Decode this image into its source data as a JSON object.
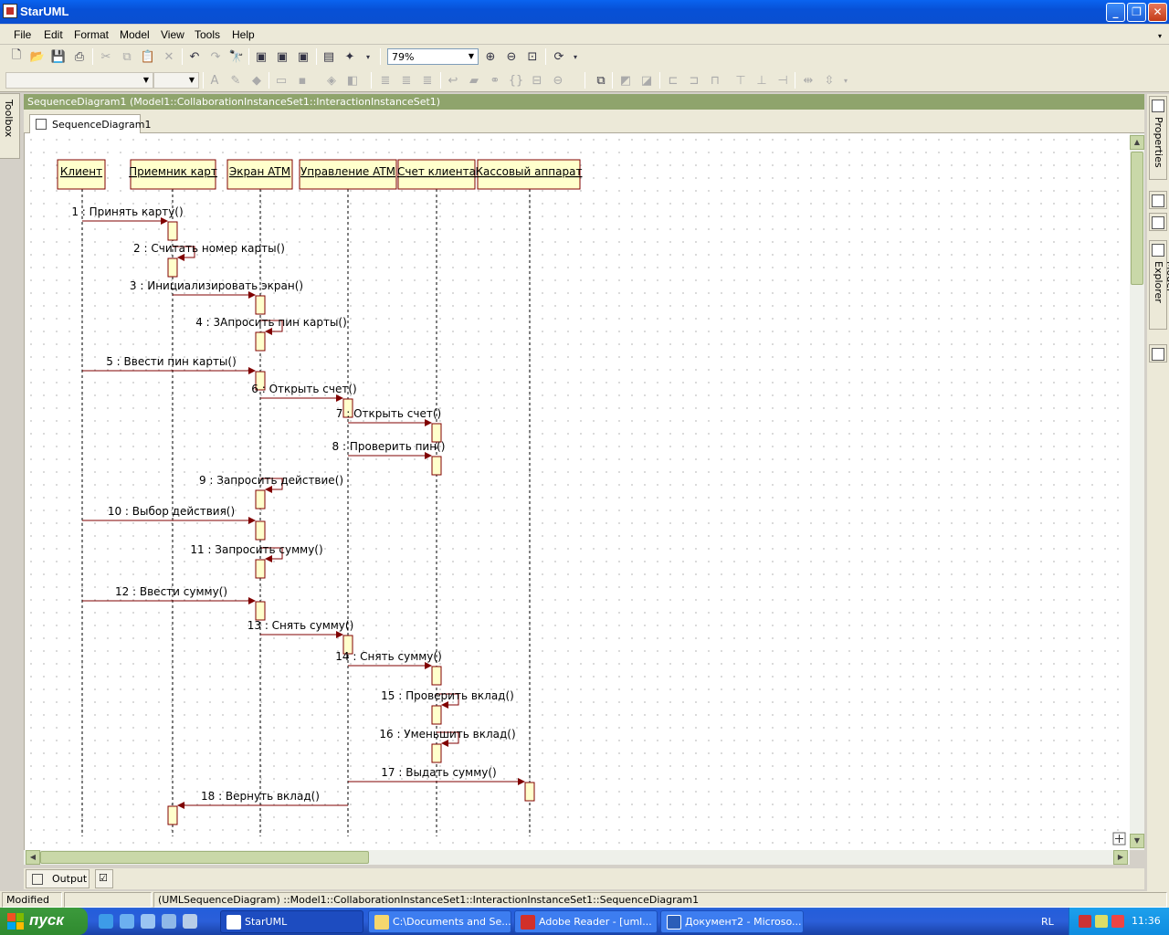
{
  "window": {
    "title": "StarUML"
  },
  "menu": [
    "File",
    "Edit",
    "Format",
    "Model",
    "View",
    "Tools",
    "Help"
  ],
  "toolbar": {
    "zoom": "79%"
  },
  "toolbox_label": "Toolbox",
  "document": {
    "header": "SequenceDiagram1 (Model1::CollaborationInstanceSet1::InteractionInstanceSet1)",
    "tab": "SequenceDiagram1"
  },
  "right_tabs": {
    "properties": "Properties",
    "model_explorer": "Model Explorer"
  },
  "diagram": {
    "objects": [
      {
        "name": "Клиент"
      },
      {
        "name": "Приемник карт"
      },
      {
        "name": "Экран ATM"
      },
      {
        "name": "Управление ATM"
      },
      {
        "name": "Счет клиента"
      },
      {
        "name": "Кассовый аппарат"
      }
    ],
    "messages": [
      {
        "label": "1 : Принять карту()",
        "from": 0,
        "to": 1
      },
      {
        "label": "2 : Считать номер карты()",
        "from": 1,
        "to": 1
      },
      {
        "label": "3 : Инициализировать экран()",
        "from": 1,
        "to": 2
      },
      {
        "label": "4 : 3Апросить пин карты()",
        "from": 2,
        "to": 2
      },
      {
        "label": "5 : Ввести пин карты()",
        "from": 0,
        "to": 2
      },
      {
        "label": "6 : Открыть счет()",
        "from": 2,
        "to": 3
      },
      {
        "label": "7 : Открыть счет()",
        "from": 3,
        "to": 4
      },
      {
        "label": "8 : Проверить пин()",
        "from": 3,
        "to": 4
      },
      {
        "label": "9 : Запросить действие()",
        "from": 2,
        "to": 2
      },
      {
        "label": "10 : Выбор действия()",
        "from": 0,
        "to": 2
      },
      {
        "label": "11 : Запросить сумму()",
        "from": 2,
        "to": 2
      },
      {
        "label": "12 : Ввести сумму()",
        "from": 0,
        "to": 2
      },
      {
        "label": "13 : Снять сумму()",
        "from": 2,
        "to": 3
      },
      {
        "label": "14 : Снять сумму()",
        "from": 3,
        "to": 4
      },
      {
        "label": "15 : Проверить вклад()",
        "from": 4,
        "to": 4
      },
      {
        "label": "16 : Уменьшить вклад()",
        "from": 4,
        "to": 4
      },
      {
        "label": "17 : Выдать сумму()",
        "from": 3,
        "to": 5
      },
      {
        "label": "18 : Вернуть вклад()",
        "from": 3,
        "to": 1
      }
    ]
  },
  "output": {
    "tab": "Output"
  },
  "status": {
    "state": "Modified",
    "path": "(UMLSequenceDiagram) ::Model1::CollaborationInstanceSet1::InteractionInstanceSet1::SequenceDiagram1"
  },
  "taskbar": {
    "start": "пуск",
    "tasks": [
      "StarUML",
      "C:\\Documents and Se...",
      "Adobe Reader - [uml...",
      "Документ2 - Microso..."
    ],
    "lang": "RL",
    "clock": "11:36"
  },
  "colors": {
    "accent": "#8fa46c",
    "object_fill": "#ffffcc",
    "message": "#800000"
  }
}
